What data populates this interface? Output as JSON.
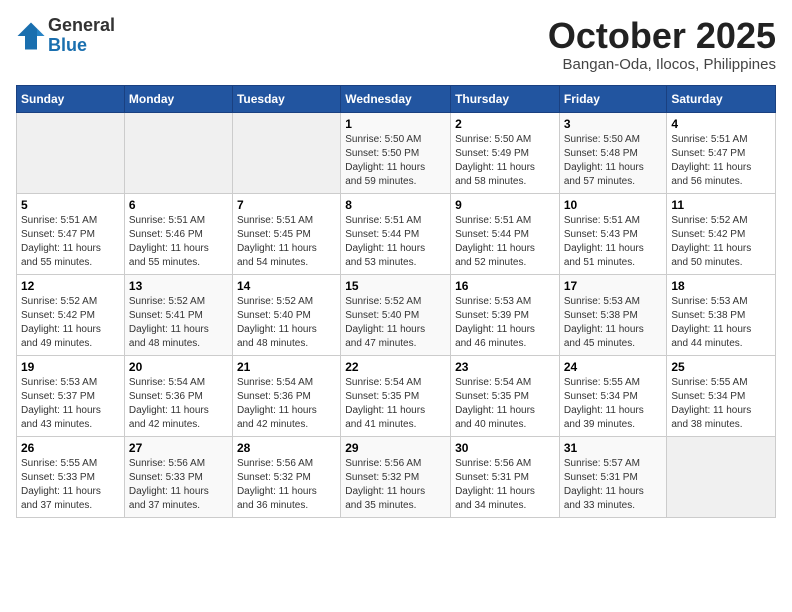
{
  "header": {
    "logo_general": "General",
    "logo_blue": "Blue",
    "month_title": "October 2025",
    "location": "Bangan-Oda, Ilocos, Philippines"
  },
  "weekdays": [
    "Sunday",
    "Monday",
    "Tuesday",
    "Wednesday",
    "Thursday",
    "Friday",
    "Saturday"
  ],
  "weeks": [
    [
      {
        "day": "",
        "info": ""
      },
      {
        "day": "",
        "info": ""
      },
      {
        "day": "",
        "info": ""
      },
      {
        "day": "1",
        "info": "Sunrise: 5:50 AM\nSunset: 5:50 PM\nDaylight: 11 hours\nand 59 minutes."
      },
      {
        "day": "2",
        "info": "Sunrise: 5:50 AM\nSunset: 5:49 PM\nDaylight: 11 hours\nand 58 minutes."
      },
      {
        "day": "3",
        "info": "Sunrise: 5:50 AM\nSunset: 5:48 PM\nDaylight: 11 hours\nand 57 minutes."
      },
      {
        "day": "4",
        "info": "Sunrise: 5:51 AM\nSunset: 5:47 PM\nDaylight: 11 hours\nand 56 minutes."
      }
    ],
    [
      {
        "day": "5",
        "info": "Sunrise: 5:51 AM\nSunset: 5:47 PM\nDaylight: 11 hours\nand 55 minutes."
      },
      {
        "day": "6",
        "info": "Sunrise: 5:51 AM\nSunset: 5:46 PM\nDaylight: 11 hours\nand 55 minutes."
      },
      {
        "day": "7",
        "info": "Sunrise: 5:51 AM\nSunset: 5:45 PM\nDaylight: 11 hours\nand 54 minutes."
      },
      {
        "day": "8",
        "info": "Sunrise: 5:51 AM\nSunset: 5:44 PM\nDaylight: 11 hours\nand 53 minutes."
      },
      {
        "day": "9",
        "info": "Sunrise: 5:51 AM\nSunset: 5:44 PM\nDaylight: 11 hours\nand 52 minutes."
      },
      {
        "day": "10",
        "info": "Sunrise: 5:51 AM\nSunset: 5:43 PM\nDaylight: 11 hours\nand 51 minutes."
      },
      {
        "day": "11",
        "info": "Sunrise: 5:52 AM\nSunset: 5:42 PM\nDaylight: 11 hours\nand 50 minutes."
      }
    ],
    [
      {
        "day": "12",
        "info": "Sunrise: 5:52 AM\nSunset: 5:42 PM\nDaylight: 11 hours\nand 49 minutes."
      },
      {
        "day": "13",
        "info": "Sunrise: 5:52 AM\nSunset: 5:41 PM\nDaylight: 11 hours\nand 48 minutes."
      },
      {
        "day": "14",
        "info": "Sunrise: 5:52 AM\nSunset: 5:40 PM\nDaylight: 11 hours\nand 48 minutes."
      },
      {
        "day": "15",
        "info": "Sunrise: 5:52 AM\nSunset: 5:40 PM\nDaylight: 11 hours\nand 47 minutes."
      },
      {
        "day": "16",
        "info": "Sunrise: 5:53 AM\nSunset: 5:39 PM\nDaylight: 11 hours\nand 46 minutes."
      },
      {
        "day": "17",
        "info": "Sunrise: 5:53 AM\nSunset: 5:38 PM\nDaylight: 11 hours\nand 45 minutes."
      },
      {
        "day": "18",
        "info": "Sunrise: 5:53 AM\nSunset: 5:38 PM\nDaylight: 11 hours\nand 44 minutes."
      }
    ],
    [
      {
        "day": "19",
        "info": "Sunrise: 5:53 AM\nSunset: 5:37 PM\nDaylight: 11 hours\nand 43 minutes."
      },
      {
        "day": "20",
        "info": "Sunrise: 5:54 AM\nSunset: 5:36 PM\nDaylight: 11 hours\nand 42 minutes."
      },
      {
        "day": "21",
        "info": "Sunrise: 5:54 AM\nSunset: 5:36 PM\nDaylight: 11 hours\nand 42 minutes."
      },
      {
        "day": "22",
        "info": "Sunrise: 5:54 AM\nSunset: 5:35 PM\nDaylight: 11 hours\nand 41 minutes."
      },
      {
        "day": "23",
        "info": "Sunrise: 5:54 AM\nSunset: 5:35 PM\nDaylight: 11 hours\nand 40 minutes."
      },
      {
        "day": "24",
        "info": "Sunrise: 5:55 AM\nSunset: 5:34 PM\nDaylight: 11 hours\nand 39 minutes."
      },
      {
        "day": "25",
        "info": "Sunrise: 5:55 AM\nSunset: 5:34 PM\nDaylight: 11 hours\nand 38 minutes."
      }
    ],
    [
      {
        "day": "26",
        "info": "Sunrise: 5:55 AM\nSunset: 5:33 PM\nDaylight: 11 hours\nand 37 minutes."
      },
      {
        "day": "27",
        "info": "Sunrise: 5:56 AM\nSunset: 5:33 PM\nDaylight: 11 hours\nand 37 minutes."
      },
      {
        "day": "28",
        "info": "Sunrise: 5:56 AM\nSunset: 5:32 PM\nDaylight: 11 hours\nand 36 minutes."
      },
      {
        "day": "29",
        "info": "Sunrise: 5:56 AM\nSunset: 5:32 PM\nDaylight: 11 hours\nand 35 minutes."
      },
      {
        "day": "30",
        "info": "Sunrise: 5:56 AM\nSunset: 5:31 PM\nDaylight: 11 hours\nand 34 minutes."
      },
      {
        "day": "31",
        "info": "Sunrise: 5:57 AM\nSunset: 5:31 PM\nDaylight: 11 hours\nand 33 minutes."
      },
      {
        "day": "",
        "info": ""
      }
    ]
  ]
}
